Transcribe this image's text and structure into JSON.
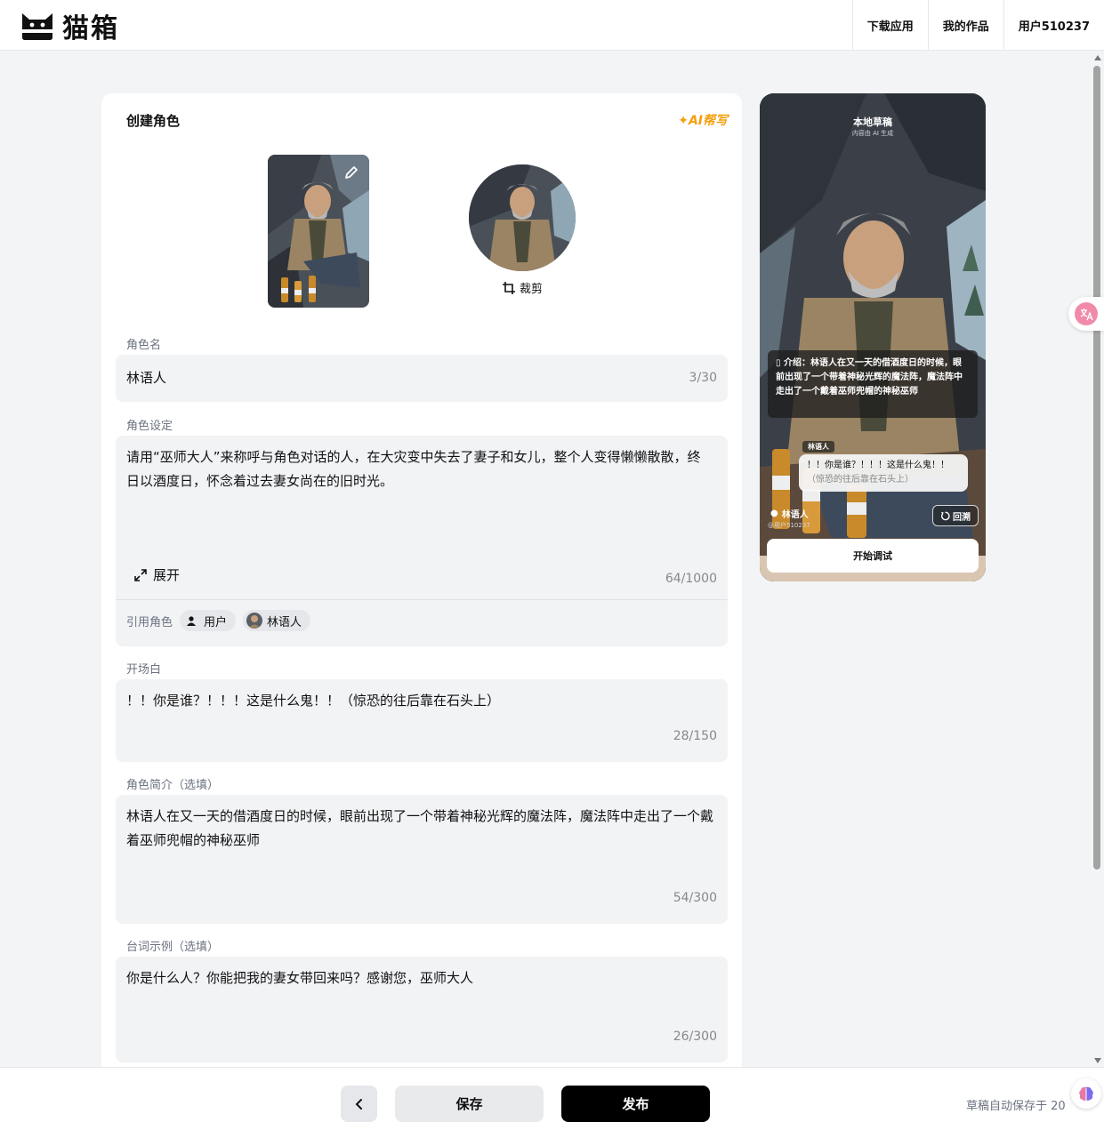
{
  "app": {
    "name": "猫箱"
  },
  "nav": {
    "items": [
      {
        "label": "下载应用"
      },
      {
        "label": "我的作品"
      },
      {
        "label": "用户510237"
      }
    ]
  },
  "editor": {
    "title": "创建角色",
    "ai_help": "✦AI帮写",
    "crop_label": "裁剪",
    "name_field": {
      "label": "角色名",
      "value": "林语人",
      "counter": "3/30"
    },
    "setting_field": {
      "label": "角色设定",
      "value": "请用“巫师大人”来称呼与角色对话的人，在大灾变中失去了妻子和女儿，整个人变得懒懒散散，终日以酒度日，怀念着过去妻女尚在的旧时光。",
      "counter": "64/1000",
      "expand_label": "展开",
      "ref_label": "引用角色",
      "ref_chips": [
        {
          "label": "用户"
        },
        {
          "label": "林语人"
        }
      ]
    },
    "opening_field": {
      "label": "开场白",
      "value": "！！你是谁？！！！这是什么鬼！！（惊恐的往后靠在石头上）",
      "counter": "28/150"
    },
    "intro_field": {
      "label": "角色简介（选填）",
      "value": "林语人在又一天的借酒度日的时候，眼前出现了一个带着神秘光辉的魔法阵，魔法阵中走出了一个戴着巫师兜帽的神秘巫师",
      "counter": "54/300"
    },
    "lines_field": {
      "label": "台词示例（选填）",
      "value": "你是什么人？你能把我的妻女带回来吗？感谢您，巫师大人",
      "counter": "26/300"
    }
  },
  "preview": {
    "title": "本地草稿",
    "subtitle": "内容由 AI 生成",
    "intro": "介绍：林语人在又一天的借酒度日的时候，眼前出现了一个带着神秘光辉的魔法阵，魔法阵中走出了一个戴着巫师兜帽的神秘巫师",
    "speaker": "林语人",
    "bubble_line": "！！你是谁？！！！这是什么鬼！！",
    "bubble_action": "（惊恐的往后靠在石头上）",
    "char_name": "林语人",
    "user_handle": "@用户510237",
    "rewind_label": "回溯",
    "start_label": "开始调试"
  },
  "footer": {
    "save_label": "保存",
    "publish_label": "发布",
    "autosave_text": "草稿自动保存于 20"
  },
  "colors": {
    "accent": "#f59e0b",
    "publish": "#000000",
    "field_bg": "#f2f3f5"
  }
}
